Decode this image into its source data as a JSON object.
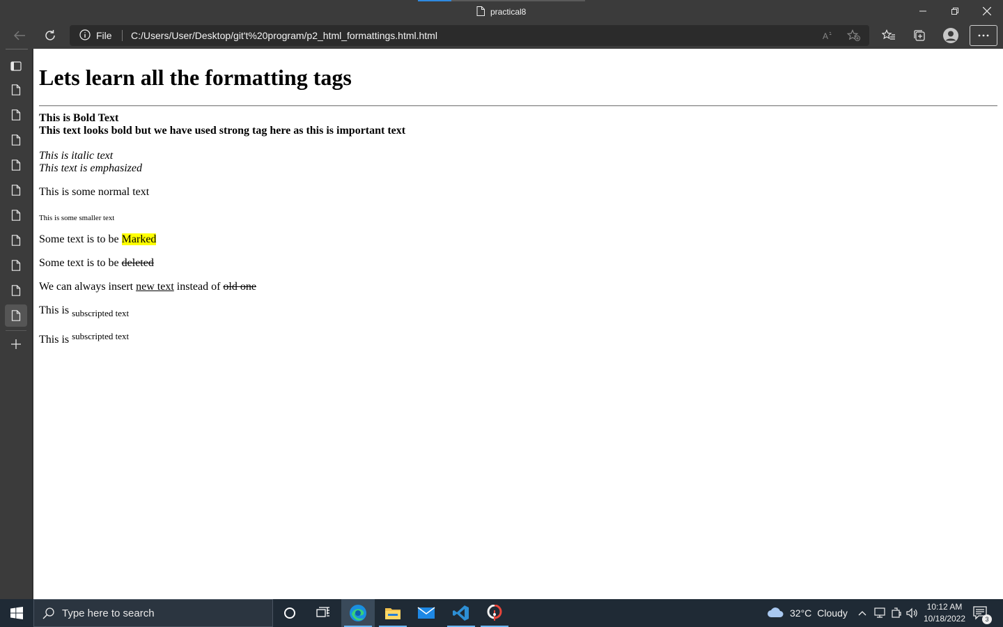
{
  "window": {
    "tab_title": "practical8"
  },
  "toolbar": {
    "address_scheme_label": "File",
    "url": "C:/Users/User/Desktop/git't%20program/p2_html_formattings.html.html"
  },
  "sidebar": {
    "items": [
      "tab-actions-icon",
      "file-icon",
      "file-icon",
      "file-icon",
      "file-icon",
      "file-icon",
      "file-icon",
      "file-icon",
      "file-icon",
      "file-icon",
      "file-icon",
      "new-tab-icon"
    ],
    "active_index": 10
  },
  "page": {
    "heading": "Lets learn all the formatting tags",
    "bold_text": "This is Bold Text",
    "strong_text": "This text looks bold but we have used strong tag here as this is important text",
    "italic_text": "This is italic text",
    "em_text": "This text is emphasized",
    "normal_text": "This is some normal text",
    "small_text": "This is some smaller text",
    "mark_line": {
      "prefix": "Some text is to be ",
      "marked": "Marked"
    },
    "del_line": {
      "prefix": "Some text is to be ",
      "deleted": "deleted"
    },
    "ins_line": {
      "prefix": "We can always insert ",
      "inserted": "new text",
      "middle": " instead of ",
      "deleted": "old one"
    },
    "sub_line": {
      "prefix": "This is ",
      "sub": "subscripted text"
    },
    "sup_line": {
      "prefix": "This is ",
      "sup": "subscripted text"
    }
  },
  "taskbar": {
    "search_placeholder": "Type here to search",
    "weather": {
      "temp": "32°C",
      "condition": "Cloudy"
    },
    "clock": {
      "time": "10:12 AM",
      "date": "10/18/2022"
    },
    "notification_count": "3"
  },
  "colors": {
    "chrome_bg": "#3b3b3b",
    "highlight": "#ffff00",
    "taskbar_bg": "#1f2a35",
    "accent": "#2f8ae0"
  }
}
